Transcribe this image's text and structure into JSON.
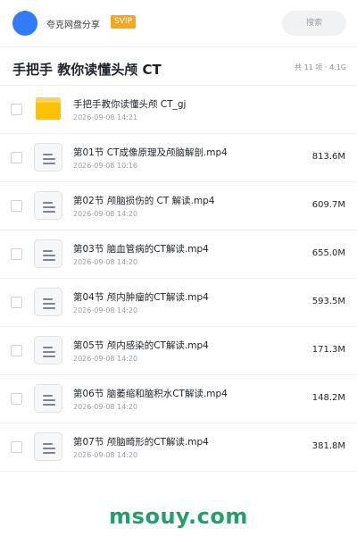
{
  "header": {
    "username": "夸克网盘分享",
    "badge": "SVIP",
    "search_placeholder": "搜索"
  },
  "title_bar": {
    "title": "手把手 教你读懂头颅 CT",
    "meta": "共 11 项 · 4.1G"
  },
  "files": [
    {
      "type": "folder",
      "name": "手把手教你读懂头颅 CT_gj",
      "date": "2026-09-08 14:21",
      "size": ""
    },
    {
      "type": "file",
      "name": "第01节 CT成像原理及颅脑解剖.mp4",
      "date": "2026-09-08 10:16",
      "size": "813.6M"
    },
    {
      "type": "file",
      "name": "第02节 颅脑损伤的 CT 解读.mp4",
      "date": "2026-09-08 14:20",
      "size": "609.7M"
    },
    {
      "type": "file",
      "name": "第03节 脑血管病的CT解读.mp4",
      "date": "2026-09-08 14:20",
      "size": "655.0M"
    },
    {
      "type": "file",
      "name": "第04节 颅内肿瘤的CT解读.mp4",
      "date": "2026-09-08 14:20",
      "size": "593.5M"
    },
    {
      "type": "file",
      "name": "第05节 颅内感染的CT解读.mp4",
      "date": "2026-09-08 14:20",
      "size": "171.3M"
    },
    {
      "type": "file",
      "name": "第06节 脑萎缩和脑积水CT解读.mp4",
      "date": "2026-09-08 14:20",
      "size": "148.2M"
    },
    {
      "type": "file",
      "name": "第07节 颅脑畸形的CT解读.mp4",
      "date": "2026-09-08 14:20",
      "size": "381.8M"
    }
  ],
  "footer": {
    "watermark": "msouy.com"
  },
  "colors": {
    "avatar": "#2f7cf6",
    "badge": "#f5a623",
    "folder": "#ffc107",
    "watermark": "#22a06b"
  },
  "icons": {
    "folder": "folder-icon",
    "file": "document-icon"
  }
}
